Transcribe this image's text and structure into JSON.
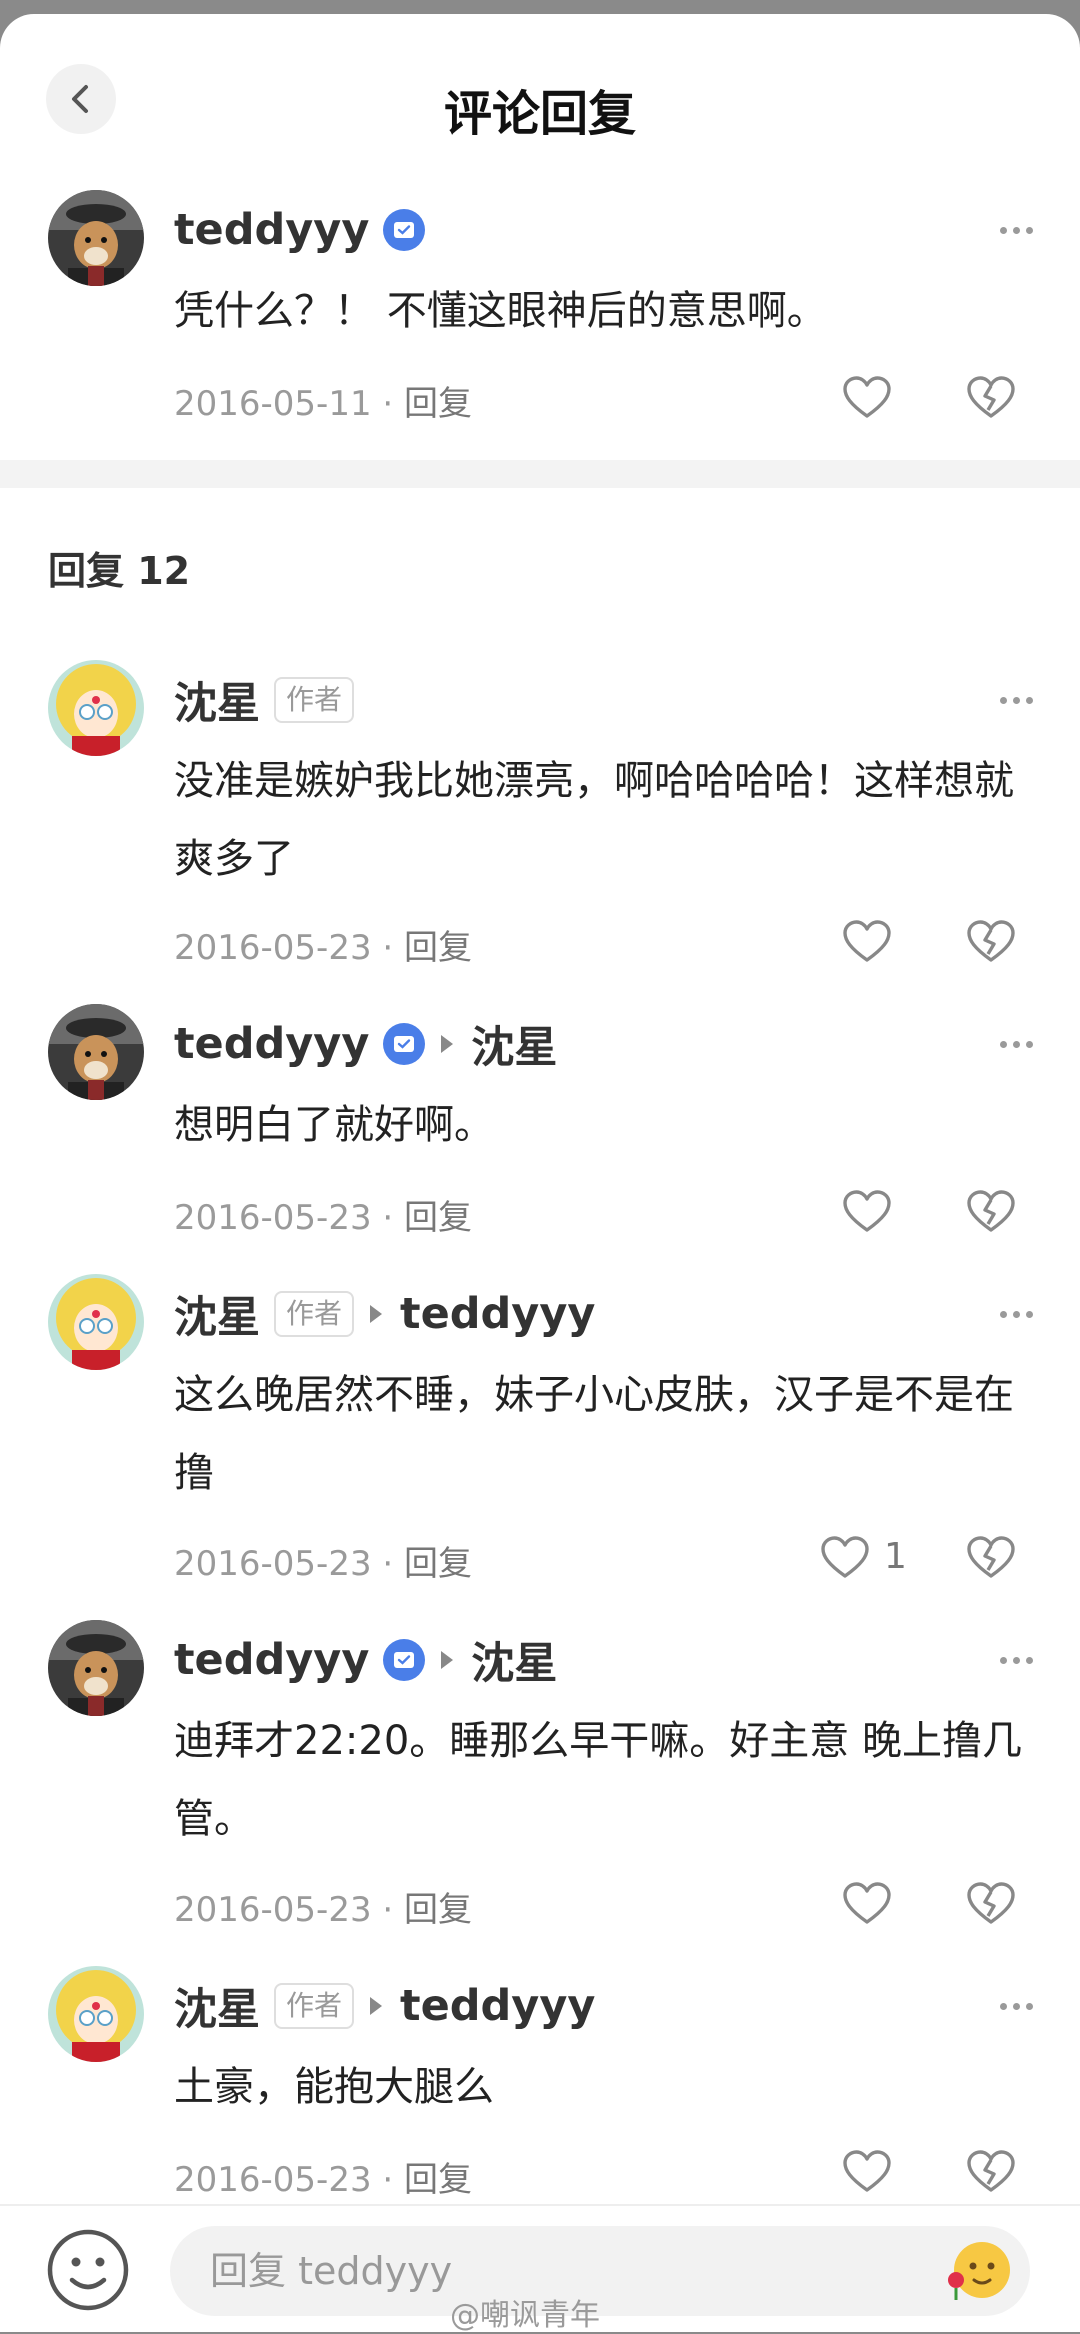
{
  "header": {
    "title": "评论回复"
  },
  "main_comment": {
    "user": "teddyyy",
    "text": "凭什么？！ 不懂这眼神后的意思啊。",
    "date": "2016-05-11",
    "reply_label": "回复"
  },
  "replies_header": "回复 12",
  "replies": [
    {
      "user": "沈星",
      "author_tag": "作者",
      "text": "没准是嫉妒我比她漂亮，啊哈哈哈哈！这样想就爽多了",
      "date": "2016-05-23",
      "reply_label": "回复"
    },
    {
      "user": "teddyyy",
      "reply_to": "沈星",
      "text": "想明白了就好啊。",
      "date": "2016-05-23",
      "reply_label": "回复"
    },
    {
      "user": "沈星",
      "author_tag": "作者",
      "reply_to": "teddyyy",
      "text": "这么晚居然不睡，妹子小心皮肤，汉子是不是在撸",
      "date": "2016-05-23",
      "reply_label": "回复",
      "likes": "1"
    },
    {
      "user": "teddyyy",
      "reply_to": "沈星",
      "text": "迪拜才22:20。睡那么早干嘛。好主意 晚上撸几管。",
      "date": "2016-05-23",
      "reply_label": "回复"
    },
    {
      "user": "沈星",
      "author_tag": "作者",
      "reply_to": "teddyyy",
      "text": "土豪，能抱大腿么",
      "date": "2016-05-23",
      "reply_label": "回复"
    }
  ],
  "composer": {
    "placeholder": "回复 teddyyy"
  },
  "watermark": "@嘲讽青年",
  "colors": {
    "verify_badge": "#4a7ee8",
    "meta": "#9a9a9a",
    "band": "#f3f3f3"
  }
}
